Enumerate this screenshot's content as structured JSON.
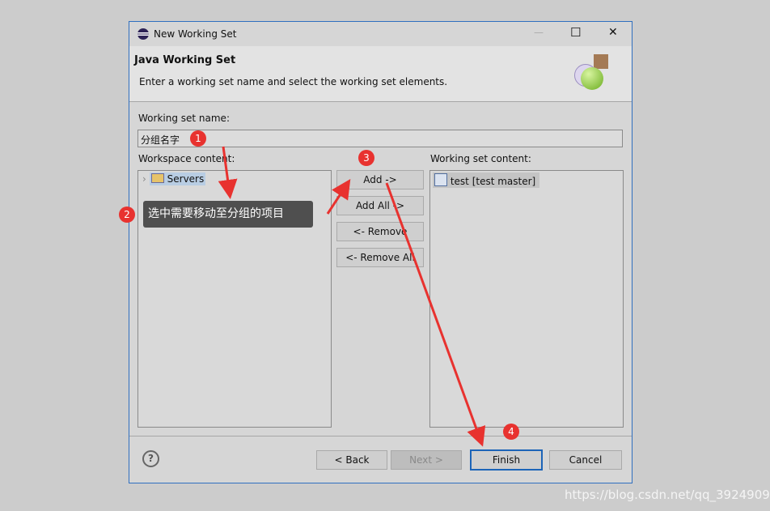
{
  "window": {
    "title": "New Working Set",
    "minimize": "—",
    "maximize": "☐",
    "close": "✕"
  },
  "header": {
    "title": "Java Working Set",
    "description": "Enter a working set name and select the working set elements."
  },
  "form": {
    "name_label": "Working set name:",
    "name_value": "分组名字",
    "workspace_label": "Workspace content:",
    "working_set_label": "Working set content:"
  },
  "workspace_items": [
    {
      "label": "Servers",
      "icon": "folder-icon"
    }
  ],
  "working_set_items": [
    {
      "label": "test [test master]",
      "icon": "java-project-icon"
    }
  ],
  "middle_buttons": {
    "add": "Add ->",
    "add_all": "Add All ->",
    "remove": "<- Remove",
    "remove_all": "<- Remove All"
  },
  "footer": {
    "back": "< Back",
    "next": "Next >",
    "finish": "Finish",
    "cancel": "Cancel",
    "help": "?"
  },
  "annotations": {
    "b1": "1",
    "b2": "2",
    "b3": "3",
    "b4": "4",
    "tooltip": "选中需要移动至分组的项目",
    "arrow_color": "#e8322f"
  },
  "watermark": "https://blog.csdn.net/qq_39249094"
}
